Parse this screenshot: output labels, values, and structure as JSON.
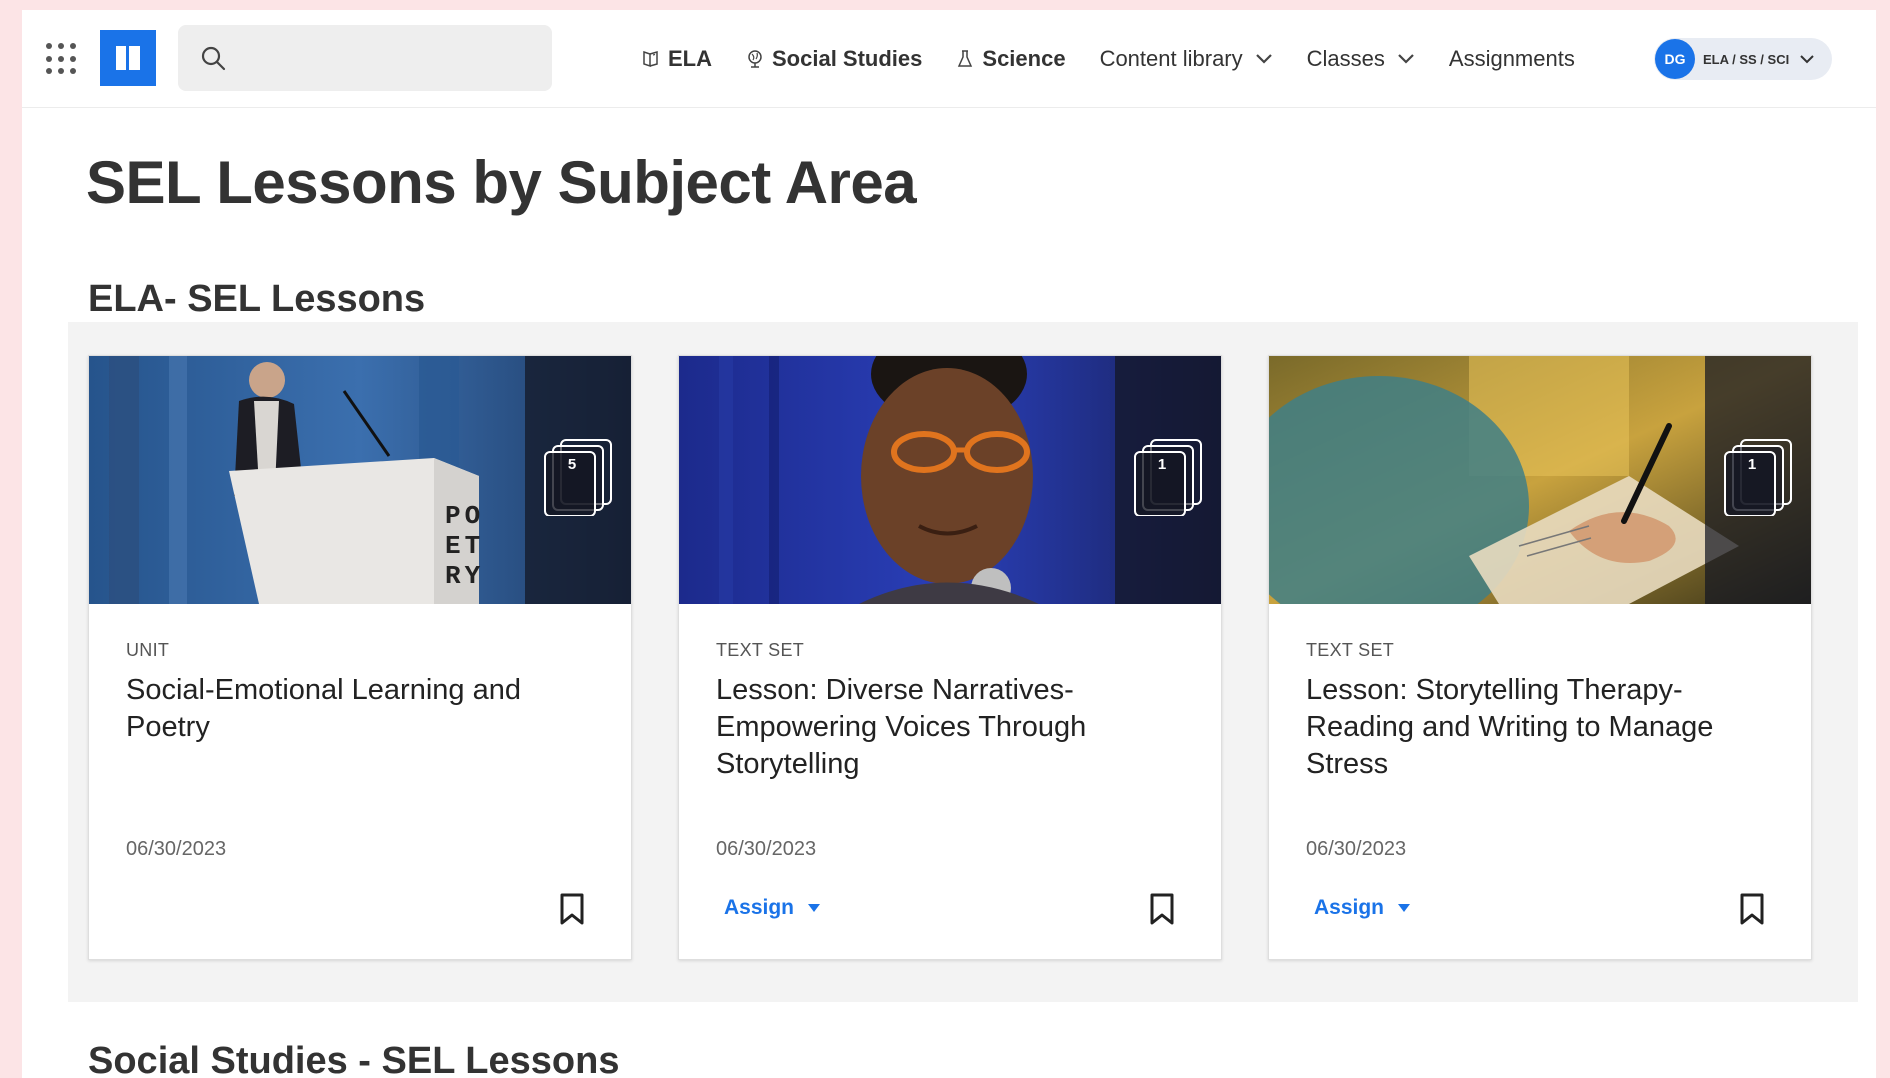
{
  "header": {
    "search_placeholder": "",
    "nav": {
      "ela": "ELA",
      "social_studies": "Social Studies",
      "science": "Science",
      "content_library": "Content library",
      "classes": "Classes",
      "assignments": "Assignments"
    },
    "user": {
      "initials": "DG",
      "label": "ELA / SS / SCI"
    }
  },
  "main": {
    "page_title": "SEL Lessons by Subject Area",
    "sections": [
      {
        "title": "ELA- SEL Lessons",
        "cards": [
          {
            "type": "UNIT",
            "title": "Social-Emotional Learning and Poetry",
            "date": "06/30/2023",
            "count": "5",
            "image_label": "PO ET RY",
            "assign": null
          },
          {
            "type": "TEXT SET",
            "title": "Lesson: Diverse Narratives- Empowering Voices Through Storytelling",
            "date": "06/30/2023",
            "count": "1",
            "assign": "Assign"
          },
          {
            "type": "TEXT SET",
            "title": "Lesson: Storytelling Therapy- Reading and Writing to Manage Stress",
            "date": "06/30/2023",
            "count": "1",
            "assign": "Assign"
          }
        ]
      },
      {
        "title": "Social Studies - SEL Lessons"
      }
    ]
  },
  "colors": {
    "accent": "#1a73e8",
    "page_border": "#fce4e6",
    "panel": "#f3f3f3"
  },
  "icons": {
    "apps": "apps-grid-icon",
    "logo": "newsela-logo-icon",
    "search": "search-icon",
    "ela": "book-icon",
    "social_studies": "globe-icon",
    "science": "flask-icon",
    "chevron": "chevron-down-icon",
    "stack": "stacked-pages-icon",
    "bookmark": "bookmark-icon",
    "caret": "caret-down-icon"
  }
}
